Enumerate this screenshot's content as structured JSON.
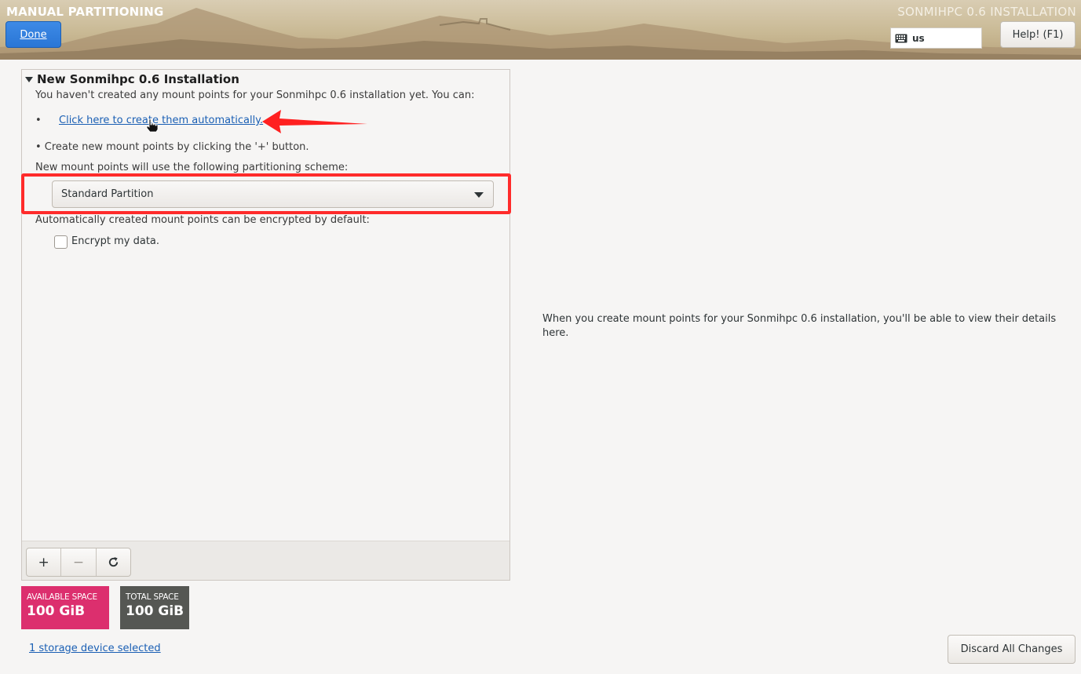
{
  "header": {
    "spoke_title": "MANUAL PARTITIONING",
    "product_title": "SONMIHPC 0.6 INSTALLATION",
    "done_label": "Done",
    "keyboard_layout": "us",
    "help_label": "Help! (F1)"
  },
  "left_panel": {
    "section_title": "New Sonmihpc 0.6 Installation",
    "intro_text": "You haven't created any mount points for your Sonmihpc 0.6 installation yet.  You can:",
    "bullet": "•",
    "auto_create_link": "Click here to create them automatically.",
    "manual_create_text": "•  Create new mount points by clicking the '+' button.",
    "scheme_label": "New mount points will use the following partitioning scheme:",
    "scheme_selected": "Standard Partition",
    "encrypt_label": "Automatically created mount points can be encrypted by default:",
    "encrypt_checkbox_label": "Encrypt my data.",
    "encrypt_checked": false
  },
  "toolbar": {
    "add_label": "+",
    "remove_label": "−",
    "refresh_label": "⟳"
  },
  "space": {
    "available_label": "AVAILABLE SPACE",
    "available_value": "100 GiB",
    "total_label": "TOTAL SPACE",
    "total_value": "100 GiB"
  },
  "storage_link": "1 storage device selected",
  "details_text": "When you create mount points for your Sonmihpc 0.6 installation, you'll be able to view their details here.",
  "discard_label": "Discard All Changes",
  "colors": {
    "accent_blue": "#2a76d6",
    "link_blue": "#1a5fb4",
    "available_space": "#dc2f6e",
    "total_space": "#555753",
    "annotation_red": "#ff2b2b"
  },
  "icons": {
    "keyboard": "keyboard-icon",
    "expander": "triangle-down-icon",
    "combo": "chevron-down-icon",
    "refresh": "refresh-icon",
    "cursor": "hand-pointer-icon",
    "annotation_arrow": "red-arrow-icon"
  }
}
